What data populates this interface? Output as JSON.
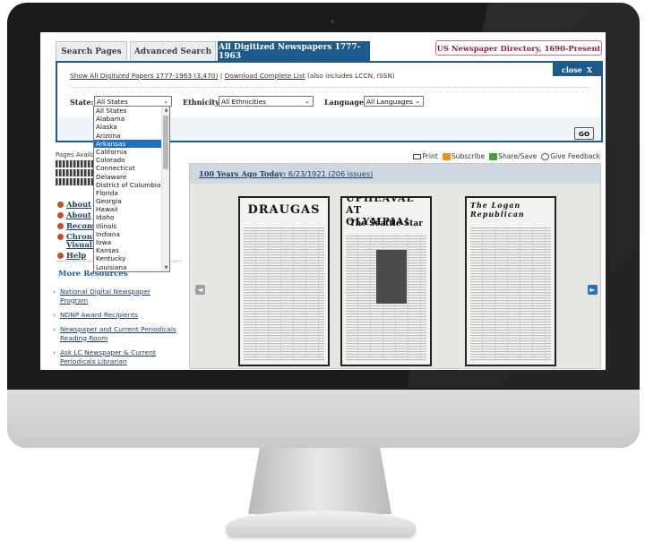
{
  "tabs": [
    "Search Pages",
    "Advanced Search",
    "All Digitized Newspapers 1777-1963"
  ],
  "directory_link": "US Newspaper Directory, 1690-Present",
  "panel": {
    "close_label": "close",
    "close_x": "X",
    "link_all": "Show All Digitized Papers 1777-1963 (3,470)",
    "separator": "|",
    "link_download": "Download Complete List",
    "download_note": "(also includes LCCN, ISSN)",
    "state_label": "State:",
    "state_value": "All States",
    "ethnicity_label": "Ethnicity:",
    "ethnicity_value": "All Ethnicities",
    "language_label": "Language:",
    "language_value": "All Languages",
    "go_label": "GO"
  },
  "state_options": [
    "All States",
    "Alabama",
    "Alaska",
    "Arizona",
    "Arkansas",
    "California",
    "Colorado",
    "Connecticut",
    "Delaware",
    "District of Columbia",
    "Florida",
    "Georgia",
    "Hawaii",
    "Idaho",
    "Illinois",
    "Indiana",
    "Iowa",
    "Kansas",
    "Kentucky",
    "Louisiana"
  ],
  "state_highlighted": "Arkansas",
  "left": {
    "pages_available": "Pages Availa",
    "links": [
      "About",
      "About",
      "Recom",
      "Chroni",
      "Visuali",
      "Help"
    ],
    "more_resources": "More Resources",
    "resources": [
      "National Digital Newspaper Program",
      "NDNP Award Recipients",
      "Newspaper and Current Periodicals Reading Room",
      "Ask LC Newspaper & Current Periodicals Librarian"
    ]
  },
  "tools": {
    "print": "Print",
    "subscribe": "Subscribe",
    "share": "Share/Save",
    "feedback": "Give Feedback"
  },
  "carousel": {
    "title_bold": "100 Years Ago Today:",
    "title_rest": "6/23/1921 (206 issues)",
    "papers": [
      {
        "masthead": "DRAUGAS"
      },
      {
        "masthead": "UPHEAVAL AT OLYMPIA!",
        "subhead": "The Seattle Star"
      },
      {
        "masthead": "The Logan Republican"
      }
    ]
  },
  "icons": [
    "print-icon",
    "rss-icon",
    "share-icon",
    "feedback-icon",
    "arrow-left-icon",
    "arrow-right-icon",
    "caret-down-icon"
  ],
  "colors": {
    "accent": "#1e5b8a",
    "highlight": "#1f6fc5",
    "directory": "#8a1e4a",
    "bullet": "#c0512b"
  }
}
